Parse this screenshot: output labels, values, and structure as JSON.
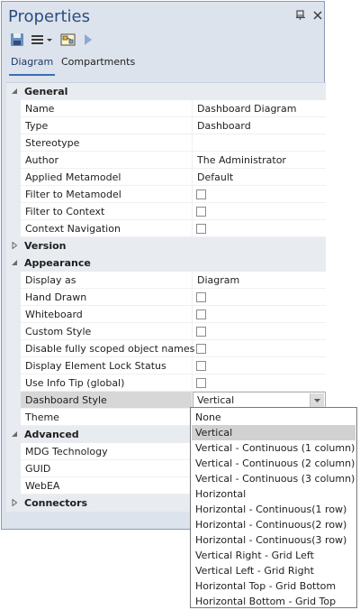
{
  "window": {
    "title": "Properties"
  },
  "tabs": [
    {
      "label": "Diagram"
    },
    {
      "label": "Compartments"
    }
  ],
  "groups": {
    "general": "General",
    "version": "Version",
    "appearance": "Appearance",
    "advanced": "Advanced",
    "connectors": "Connectors"
  },
  "general": {
    "rows": [
      {
        "name": "Name",
        "value": "Dashboard Diagram"
      },
      {
        "name": "Type",
        "value": "Dashboard"
      },
      {
        "name": "Stereotype",
        "value": ""
      },
      {
        "name": "Author",
        "value": "The Administrator"
      },
      {
        "name": "Applied Metamodel",
        "value": "Default"
      },
      {
        "name": "Filter to Metamodel",
        "checked": false
      },
      {
        "name": "Filter to Context",
        "checked": false
      },
      {
        "name": "Context Navigation",
        "checked": false
      }
    ]
  },
  "appearance": {
    "rows": [
      {
        "name": "Display as",
        "value": "Diagram"
      },
      {
        "name": "Hand Drawn",
        "checked": false
      },
      {
        "name": "Whiteboard",
        "checked": false
      },
      {
        "name": "Custom Style",
        "checked": false
      },
      {
        "name": "Disable fully scoped object names",
        "checked": false
      },
      {
        "name": "Display Element Lock Status",
        "checked": false
      },
      {
        "name": "Use Info Tip (global)",
        "checked": false
      },
      {
        "name": "Dashboard Style",
        "value": "Vertical"
      },
      {
        "name": "Theme",
        "value": ""
      }
    ]
  },
  "advanced": {
    "rows": [
      {
        "name": "MDG Technology",
        "value": ""
      },
      {
        "name": "GUID",
        "value": ""
      },
      {
        "name": "WebEA",
        "value": ""
      }
    ]
  },
  "dropdown": {
    "selected": "Vertical",
    "options": [
      "None",
      "Vertical",
      "Vertical - Continuous (1 column)",
      "Vertical - Continuous (2 column)",
      "Vertical - Continuous (3 column)",
      "Horizontal",
      "Horizontal - Continuous(1 row)",
      "Horizontal - Continuous(2 row)",
      "Horizontal - Continuous(3 row)",
      "Vertical Right - Grid Left",
      "Vertical Left - Grid Right",
      "Horizontal Top - Grid Bottom",
      "Horizontal Bottom - Grid Top"
    ]
  }
}
